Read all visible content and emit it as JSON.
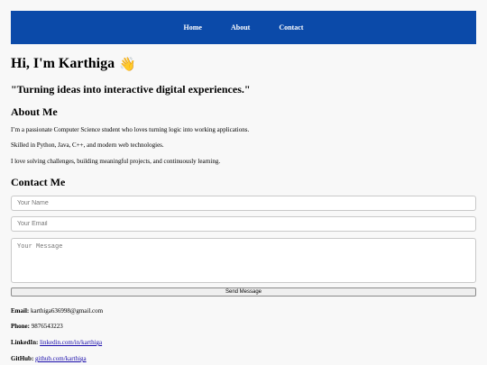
{
  "nav": {
    "items": [
      {
        "label": "Home"
      },
      {
        "label": "About"
      },
      {
        "label": "Contact"
      }
    ],
    "background": "#0b4aa9"
  },
  "hero": {
    "title": "Hi, I'm Karthiga",
    "emoji": "👋",
    "tagline": "\"Turning ideas into interactive digital experiences.\""
  },
  "about": {
    "title": "About Me",
    "paragraphs": [
      "I’m a passionate Computer Science student who loves turning logic into working applications.",
      "Skilled in Python, Java, C++, and modern web technologies.",
      "I love solving challenges, building meaningful projects, and continuously learning."
    ]
  },
  "contact": {
    "title": "Contact Me",
    "name_placeholder": "Your Name",
    "email_placeholder": "Your Email",
    "message_placeholder": "Your Message",
    "send_label": "Send Message",
    "email_label": "Email:",
    "email_value": "karthiga636998@gmail.com",
    "phone_label": "Phone:",
    "phone_value": "9876543223",
    "linkedin_label": "LinkedIn:",
    "linkedin_value": "linkedin.com/in/karthiga",
    "github_label": "GitHub:",
    "github_value": "github.com/karthiga"
  }
}
